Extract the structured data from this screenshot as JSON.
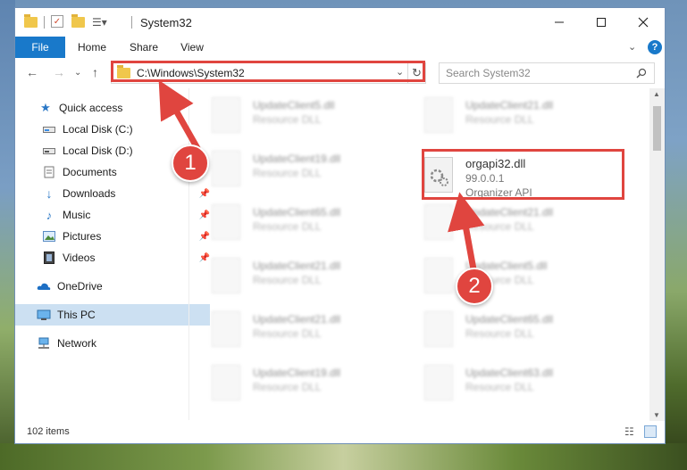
{
  "window": {
    "title": "System32"
  },
  "ribbon": {
    "tabs": [
      "File",
      "Home",
      "Share",
      "View"
    ]
  },
  "address": {
    "path": "C:\\Windows\\System32",
    "search_placeholder": "Search System32"
  },
  "sidebar": {
    "quick_access": "Quick access",
    "items": [
      {
        "label": "Local Disk (C:)",
        "icon": "drive-icon",
        "pinned": false
      },
      {
        "label": "Local Disk (D:)",
        "icon": "drive-icon",
        "pinned": false
      },
      {
        "label": "Documents",
        "icon": "documents-icon",
        "pinned": false
      },
      {
        "label": "Downloads",
        "icon": "downloads-icon",
        "pinned": true
      },
      {
        "label": "Music",
        "icon": "music-icon",
        "pinned": true
      },
      {
        "label": "Pictures",
        "icon": "pictures-icon",
        "pinned": true
      },
      {
        "label": "Videos",
        "icon": "videos-icon",
        "pinned": true
      }
    ],
    "onedrive": "OneDrive",
    "this_pc": "This PC",
    "network": "Network"
  },
  "files": {
    "col1": [
      {
        "name": "UpdateClient5.dll",
        "type": "Resource DLL"
      },
      {
        "name": "UpdateClient19.dll",
        "type": "Resource DLL"
      },
      {
        "name": "UpdateClient65.dll",
        "type": "Resource DLL"
      },
      {
        "name": "UpdateClient21.dll",
        "type": "Resource DLL"
      },
      {
        "name": "UpdateClient21.dll",
        "type": "Resource DLL"
      },
      {
        "name": "UpdateClient19.dll",
        "type": "Resource DLL"
      }
    ],
    "col2": [
      {
        "name": "UpdateClient21.dll",
        "type": "Resource DLL"
      },
      {
        "name": "orgapi32.dll",
        "version": "99.0.0.1",
        "type": "Organizer API",
        "highlighted": true
      },
      {
        "name": "UpdateClient21.dll",
        "type": "Resource DLL"
      },
      {
        "name": "UpdateClient5.dll",
        "type": "Resource DLL"
      },
      {
        "name": "UpdateClient65.dll",
        "type": "Resource DLL"
      },
      {
        "name": "UpdateClient63.dll",
        "type": "Resource DLL"
      }
    ]
  },
  "status": {
    "item_count": "102 items"
  },
  "annotations": {
    "step1": "1",
    "step2": "2",
    "color": "#e0453f"
  }
}
